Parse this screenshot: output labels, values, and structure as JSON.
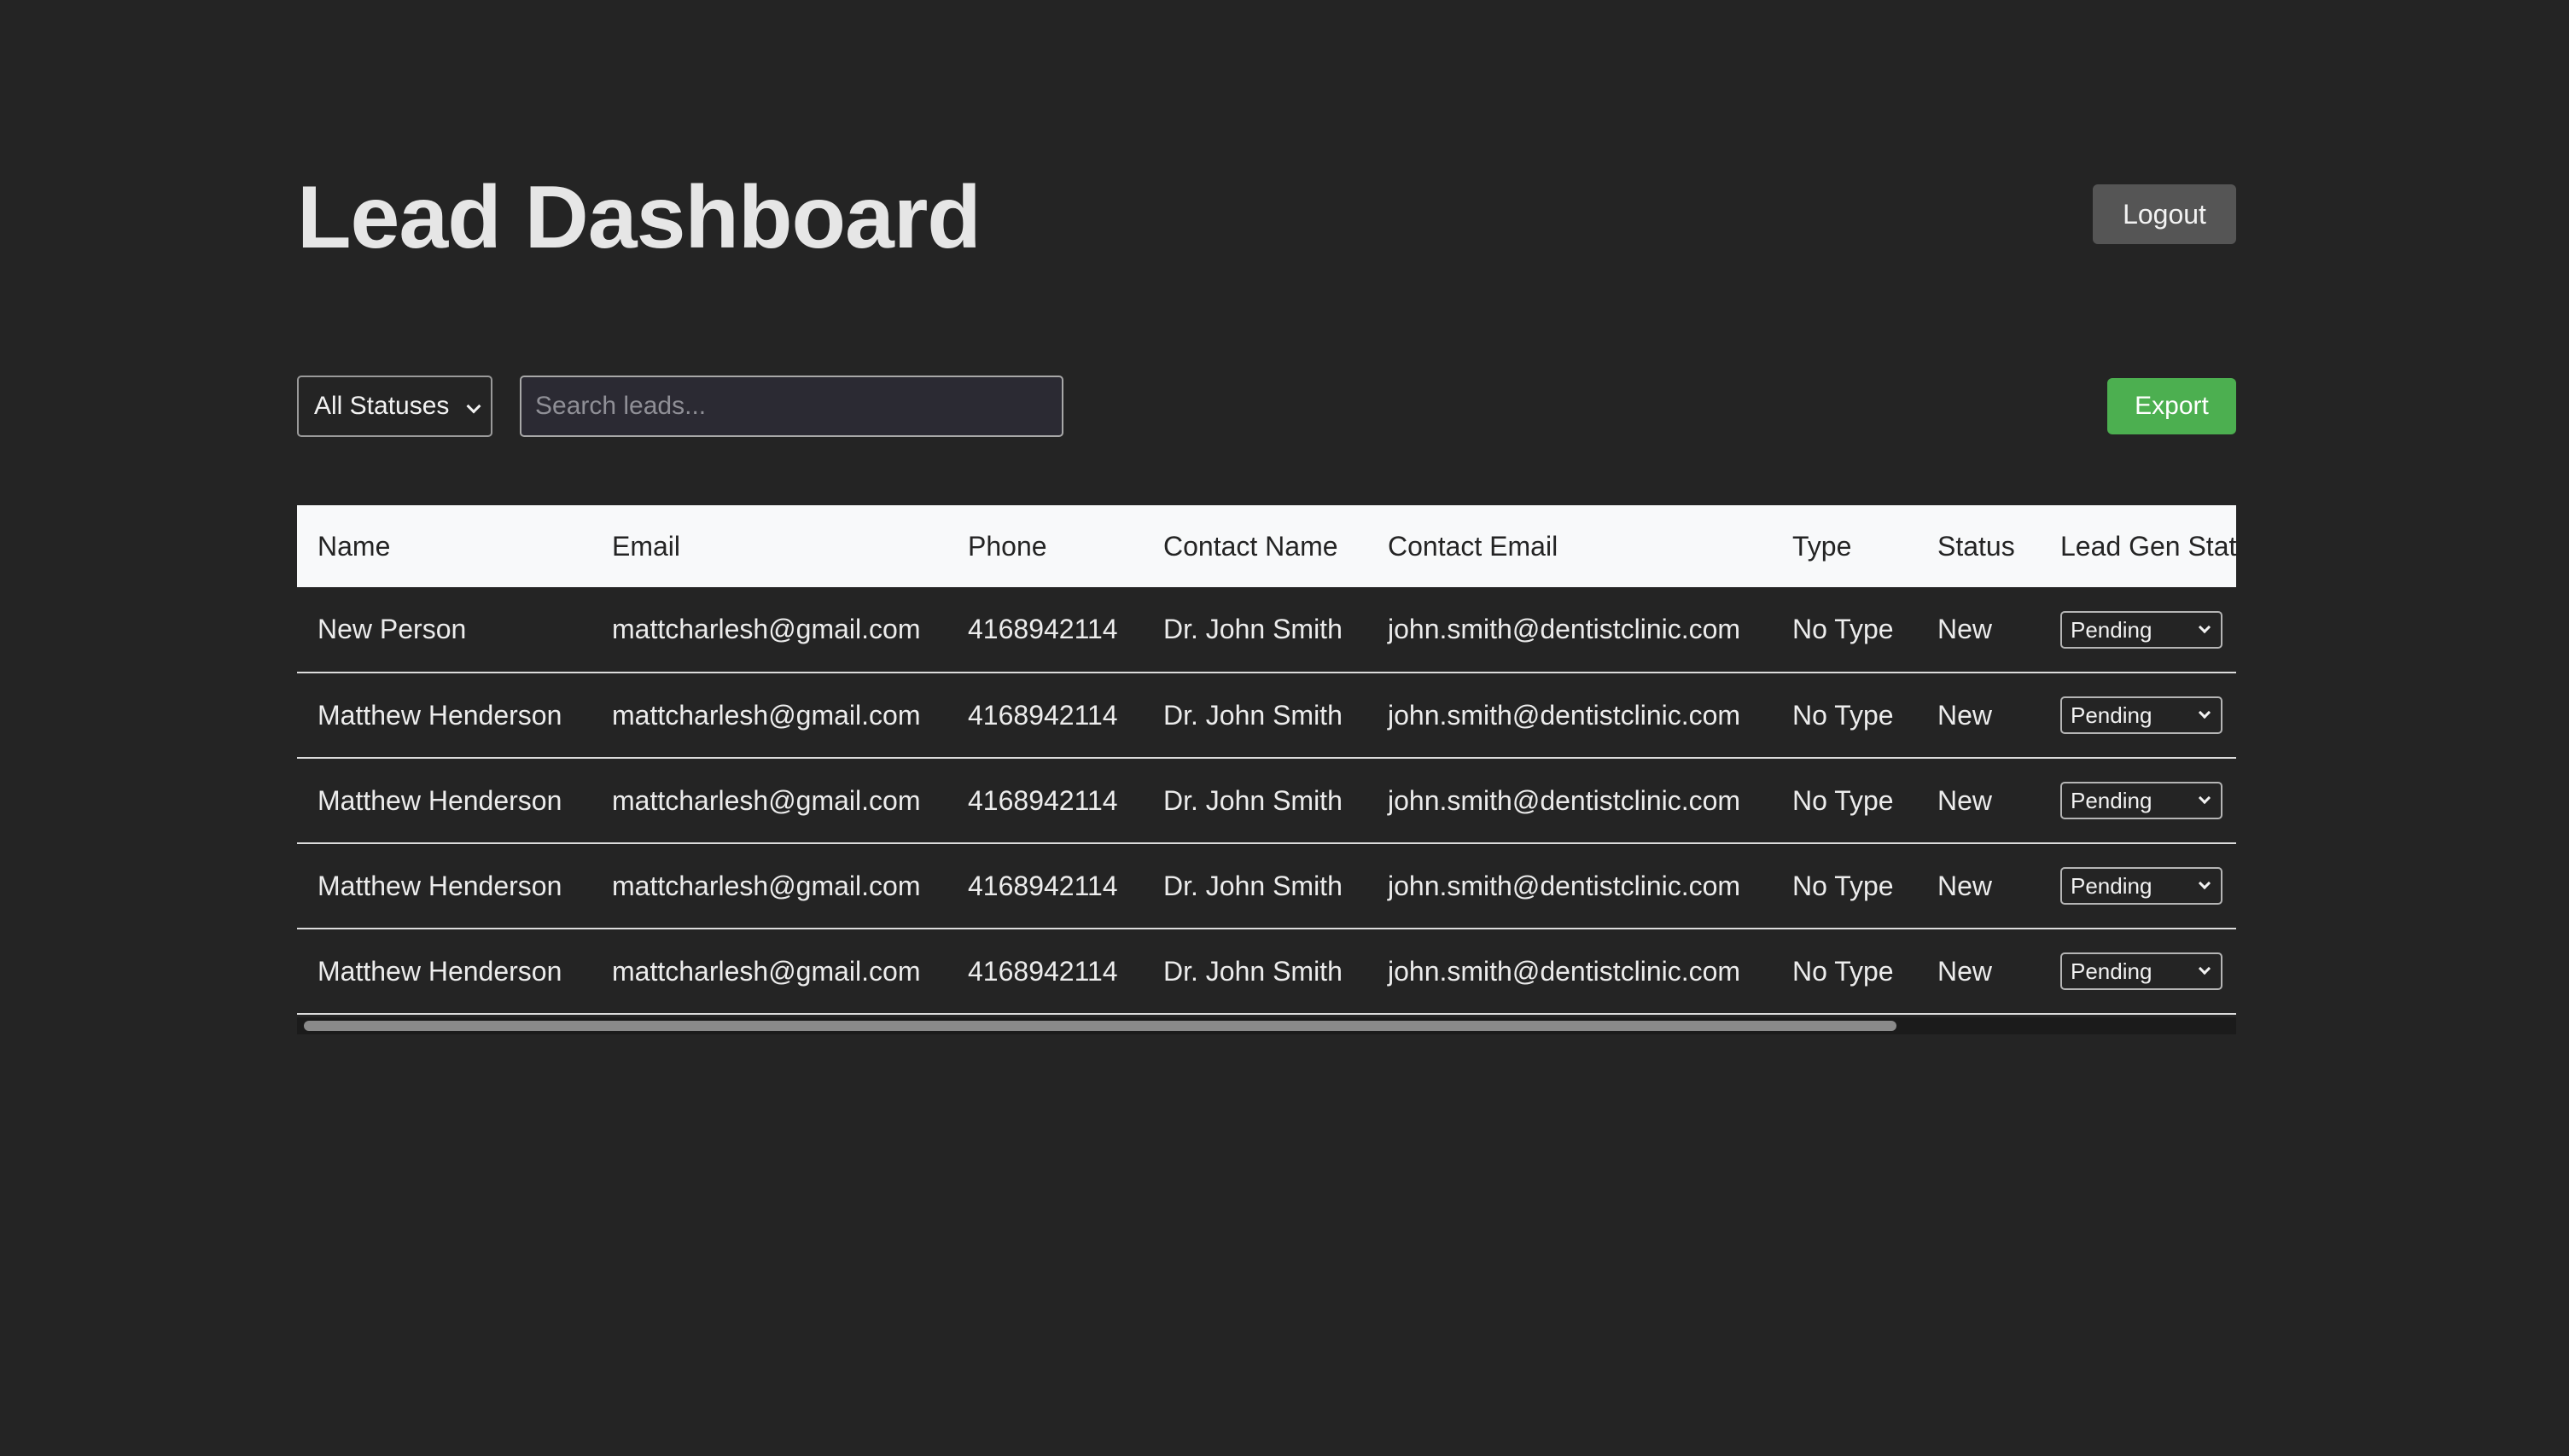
{
  "header": {
    "title": "Lead Dashboard",
    "logout_label": "Logout"
  },
  "toolbar": {
    "status_filter_value": "All Statuses",
    "search_placeholder": "Search leads...",
    "search_value": "",
    "export_label": "Export"
  },
  "table": {
    "columns": [
      "Name",
      "Email",
      "Phone",
      "Contact Name",
      "Contact Email",
      "Type",
      "Status",
      "Lead Gen Status"
    ],
    "rows": [
      {
        "name": "New Person",
        "email": "mattcharlesh@gmail.com",
        "phone": "4168942114",
        "contact_name": "Dr. John Smith",
        "contact_email": "john.smith@dentistclinic.com",
        "type": "No Type",
        "status": "New",
        "lead_gen_status": "Pending"
      },
      {
        "name": "Matthew Henderson",
        "email": "mattcharlesh@gmail.com",
        "phone": "4168942114",
        "contact_name": "Dr. John Smith",
        "contact_email": "john.smith@dentistclinic.com",
        "type": "No Type",
        "status": "New",
        "lead_gen_status": "Pending"
      },
      {
        "name": "Matthew Henderson",
        "email": "mattcharlesh@gmail.com",
        "phone": "4168942114",
        "contact_name": "Dr. John Smith",
        "contact_email": "john.smith@dentistclinic.com",
        "type": "No Type",
        "status": "New",
        "lead_gen_status": "Pending"
      },
      {
        "name": "Matthew Henderson",
        "email": "mattcharlesh@gmail.com",
        "phone": "4168942114",
        "contact_name": "Dr. John Smith",
        "contact_email": "john.smith@dentistclinic.com",
        "type": "No Type",
        "status": "New",
        "lead_gen_status": "Pending"
      },
      {
        "name": "Matthew Henderson",
        "email": "mattcharlesh@gmail.com",
        "phone": "4168942114",
        "contact_name": "Dr. John Smith",
        "contact_email": "john.smith@dentistclinic.com",
        "type": "No Type",
        "status": "New",
        "lead_gen_status": "Pending"
      }
    ]
  },
  "icons": {
    "dropdown": "chevron-down-icon"
  },
  "colors": {
    "background": "#242424",
    "export_button": "#4caf50",
    "logout_button": "#555555",
    "table_header_bg": "#f8f9fa"
  }
}
